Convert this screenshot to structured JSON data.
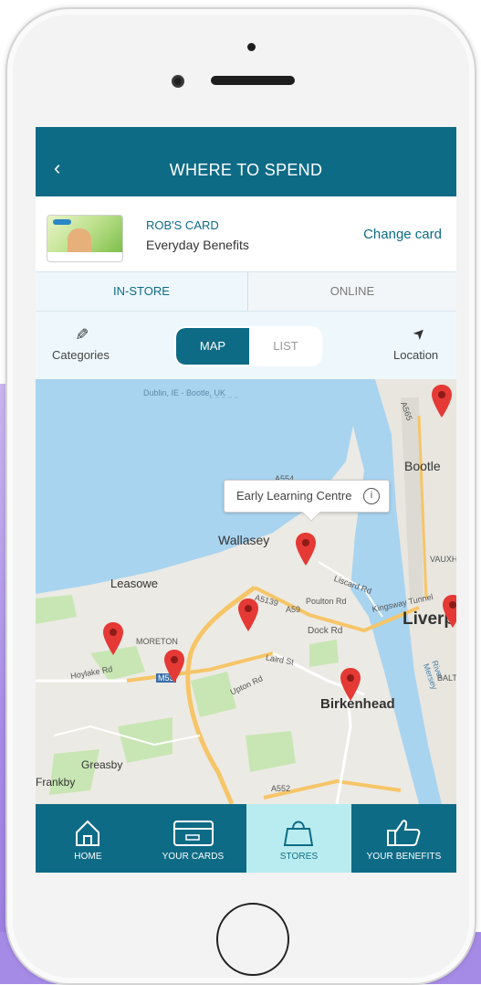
{
  "header": {
    "back_icon": "chevron-left-icon",
    "title": "WHERE TO SPEND"
  },
  "card": {
    "name": "ROB'S CARD",
    "subtitle": "Everyday Benefits",
    "change_label": "Change card"
  },
  "tabs": [
    {
      "label": "IN-STORE",
      "active": true
    },
    {
      "label": "ONLINE",
      "active": false
    }
  ],
  "toolbar": {
    "categories_label": "Categories",
    "map_label": "MAP",
    "list_label": "LIST",
    "location_label": "Location"
  },
  "map": {
    "callout": "Early Learning Centre",
    "labels": {
      "dublin": "Dublin, IE - Bootle, UK",
      "bootle": "Bootle",
      "wallasey": "Wallasey",
      "leasowe": "Leasowe",
      "moreton": "MORETON",
      "birkenhead": "Birkenhead",
      "liverpool": "Liverp",
      "greasby": "Greasby",
      "frankby": "Frankby",
      "kingsway": "Kingsway Tunnel",
      "river_mersey": "River Mersey",
      "hoylake_rd": "Hoylake Rd",
      "dock_rd": "Dock Rd",
      "a5139": "A5139",
      "a59": "A59",
      "a552": "A552",
      "m53": "M53",
      "a554": "A554",
      "a565": "A565",
      "upton_rd": "Upton Rd",
      "liscard_rd": "Liscard Rd",
      "poulton_rd": "Poulton Rd",
      "laird_st": "Laird St",
      "baltic": "BALT",
      "vauxhall": "VAUXH"
    },
    "colors": {
      "water": "#a9d4f0",
      "land": "#eceae4",
      "park": "#c8e6b4",
      "road": "#f6c568",
      "pin": "#e53935"
    }
  },
  "nav": [
    {
      "label": "HOME",
      "icon": "home-icon"
    },
    {
      "label": "YOUR CARDS",
      "icon": "card-icon"
    },
    {
      "label": "STORES",
      "icon": "shopping-bag-icon",
      "active": true
    },
    {
      "label": "YOUR BENEFITS",
      "icon": "thumbs-up-icon"
    }
  ]
}
